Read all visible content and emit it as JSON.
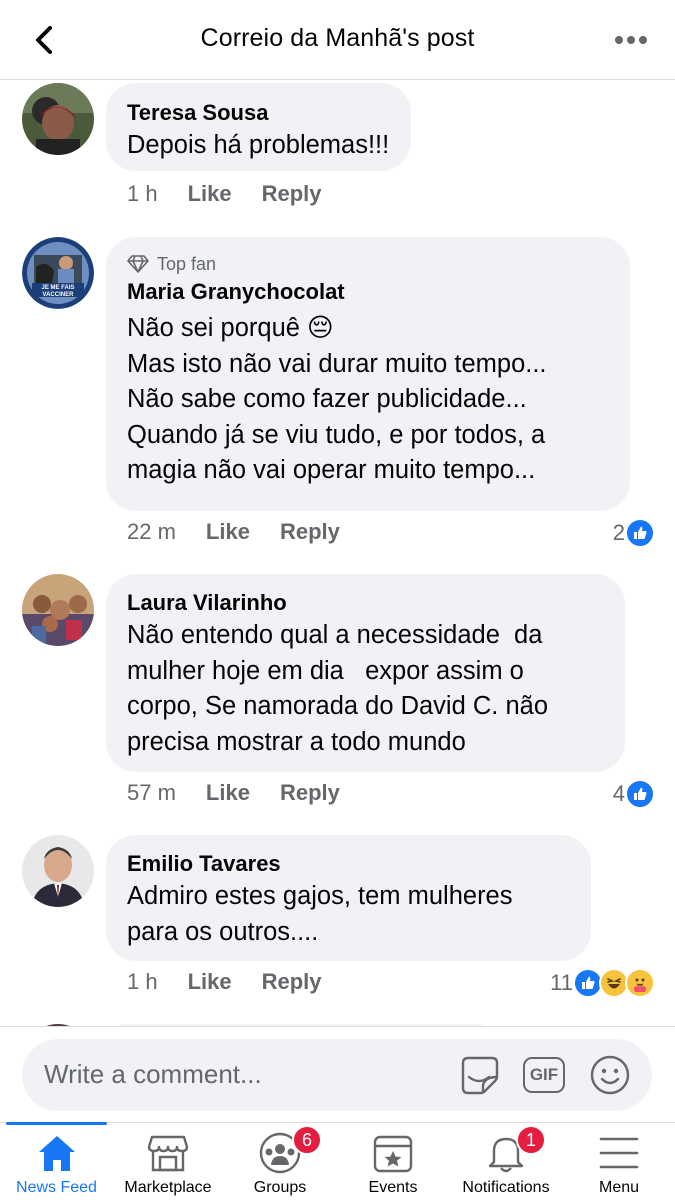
{
  "header": {
    "title": "Correio da Manhã's post"
  },
  "comments": [
    {
      "author": "Teresa Sousa",
      "text": "Depois há problemas!!!",
      "time": "1 h",
      "like": "Like",
      "reply": "Reply",
      "reaction_count": "",
      "reactions": []
    },
    {
      "badge": "Top fan",
      "author": "Maria Granychocolat",
      "text": "Não sei porquê 😔\nMas isto não vai durar muito tempo...\nNão sabe como fazer publicidade...\nQuando já se viu tudo, e por todos, a\nmagia não vai operar muito tempo...",
      "avatar_text": "JE ME FAIS VACCINER",
      "time": "22 m",
      "like": "Like",
      "reply": "Reply",
      "reaction_count": "2",
      "reactions": [
        "like"
      ]
    },
    {
      "author": "Laura Vilarinho",
      "text": "Não entendo qual a necessidade  da\nmulher hoje em dia   expor assim o\ncorpo, Se namorada do David C. não\nprecisa mostrar a todo mundo",
      "time": "57 m",
      "like": "Like",
      "reply": "Reply",
      "reaction_count": "4",
      "reactions": [
        "like"
      ]
    },
    {
      "author": "Emilio Tavares",
      "text": "Admiro estes gajos, tem mulheres\npara os outros....",
      "time": "1 h",
      "like": "Like",
      "reply": "Reply",
      "reaction_count": "11",
      "reactions": [
        "like",
        "haha",
        "care"
      ]
    }
  ],
  "composer": {
    "placeholder": "Write a comment...",
    "gif_label": "GIF"
  },
  "tabbar": {
    "tabs": [
      {
        "label": "News Feed",
        "icon": "home-icon",
        "active": true
      },
      {
        "label": "Marketplace",
        "icon": "marketplace-icon"
      },
      {
        "label": "Groups",
        "icon": "groups-icon",
        "badge": "6"
      },
      {
        "label": "Events",
        "icon": "events-icon"
      },
      {
        "label": "Notifications",
        "icon": "bell-icon",
        "badge": "1"
      },
      {
        "label": "Menu",
        "icon": "menu-icon"
      }
    ]
  },
  "colors": {
    "accent": "#1877f2",
    "bubble": "#f0f2f5",
    "secondary_text": "#65676b",
    "badge_red": "#e41e3f"
  }
}
